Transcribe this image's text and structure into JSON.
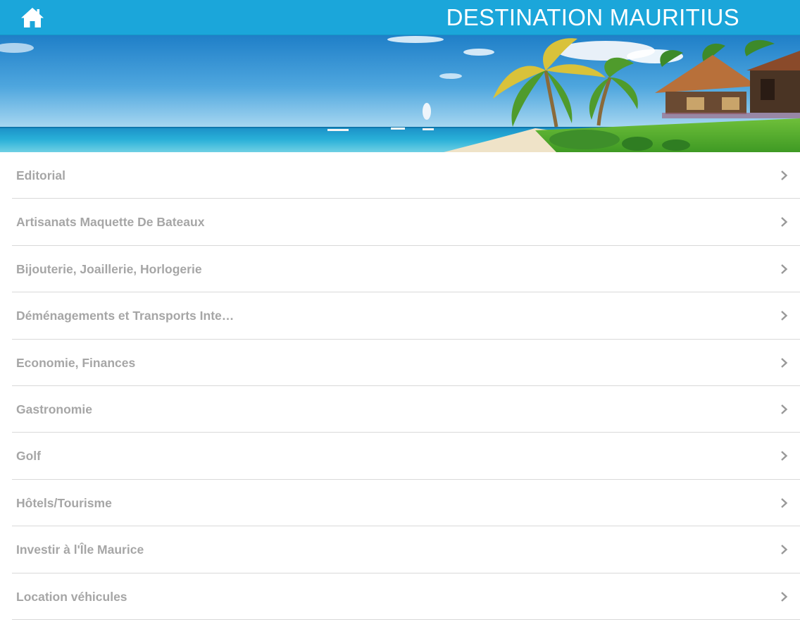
{
  "header": {
    "title": "DESTINATION MAURITIUS",
    "home_icon": "home-icon",
    "background_color": "#1ba6da"
  },
  "banner": {
    "description_icon": "beach-banner-image"
  },
  "menu": {
    "items": [
      {
        "label": "Editorial"
      },
      {
        "label": "Artisanats Maquette De Bateaux"
      },
      {
        "label": "Bijouterie, Joaillerie, Horlogerie"
      },
      {
        "label": "Déménagements et Transports Inte…"
      },
      {
        "label": "Economie, Finances"
      },
      {
        "label": "Gastronomie"
      },
      {
        "label": "Golf"
      },
      {
        "label": "Hôtels/Tourisme"
      },
      {
        "label": "Investir à l'Île Maurice"
      },
      {
        "label": "Location véhicules"
      }
    ],
    "chevron_icon": "chevron-right-icon",
    "text_color": "#a6a6a6"
  }
}
